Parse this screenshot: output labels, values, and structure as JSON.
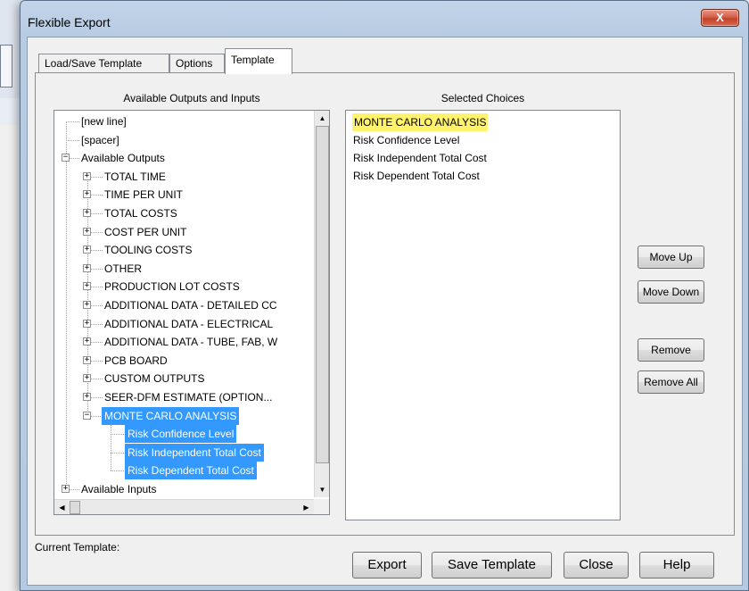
{
  "window": {
    "title": "Flexible Export",
    "close_glyph": "X"
  },
  "tabs": [
    {
      "label": "Load/Save Template"
    },
    {
      "label": "Options"
    },
    {
      "label": "Template"
    }
  ],
  "left_panel": {
    "header": "Available Outputs and Inputs"
  },
  "right_panel": {
    "header": "Selected Choices"
  },
  "tree": [
    {
      "label": "[new line]",
      "level": 1,
      "expander": "none"
    },
    {
      "label": "[spacer]",
      "level": 1,
      "expander": "none"
    },
    {
      "label": "Available Outputs",
      "level": 1,
      "expander": "minus"
    },
    {
      "label": "TOTAL TIME",
      "level": 2,
      "expander": "plus"
    },
    {
      "label": "TIME PER UNIT",
      "level": 2,
      "expander": "plus"
    },
    {
      "label": "TOTAL COSTS",
      "level": 2,
      "expander": "plus"
    },
    {
      "label": "COST PER UNIT",
      "level": 2,
      "expander": "plus"
    },
    {
      "label": "TOOLING COSTS",
      "level": 2,
      "expander": "plus"
    },
    {
      "label": "OTHER",
      "level": 2,
      "expander": "plus"
    },
    {
      "label": "PRODUCTION LOT COSTS",
      "level": 2,
      "expander": "plus"
    },
    {
      "label": "ADDITIONAL DATA - DETAILED CC",
      "level": 2,
      "expander": "plus"
    },
    {
      "label": "ADDITIONAL DATA - ELECTRICAL",
      "level": 2,
      "expander": "plus"
    },
    {
      "label": "ADDITIONAL DATA - TUBE, FAB, W",
      "level": 2,
      "expander": "plus"
    },
    {
      "label": "PCB BOARD",
      "level": 2,
      "expander": "plus"
    },
    {
      "label": "CUSTOM OUTPUTS",
      "level": 2,
      "expander": "plus"
    },
    {
      "label": "SEER-DFM ESTIMATE (OPTION...",
      "level": 2,
      "expander": "plus"
    },
    {
      "label": "MONTE CARLO ANALYSIS",
      "level": 2,
      "expander": "minus",
      "selected": true
    },
    {
      "label": "Risk Confidence Level",
      "level": 3,
      "expander": "none",
      "selected": true
    },
    {
      "label": "Risk Independent Total Cost",
      "level": 3,
      "expander": "none",
      "selected": true
    },
    {
      "label": "Risk Dependent Total Cost",
      "level": 3,
      "expander": "none",
      "selected": true
    },
    {
      "label": "Available Inputs",
      "level": 1,
      "expander": "plus"
    }
  ],
  "selected_choices": [
    {
      "label": "MONTE CARLO ANALYSIS",
      "highlighted": true
    },
    {
      "label": "Risk Confidence Level"
    },
    {
      "label": "Risk Independent Total Cost"
    },
    {
      "label": "Risk Dependent Total Cost"
    }
  ],
  "side_buttons": {
    "move_up": "Move Up",
    "move_down": "Move Down",
    "remove": "Remove",
    "remove_all": "Remove All"
  },
  "status": {
    "current_template_label": "Current Template:"
  },
  "footer_buttons": {
    "export": "Export",
    "save_template": "Save Template",
    "close": "Close",
    "help": "Help"
  },
  "colors": {
    "selection": "#3399ff",
    "highlight": "#fff36b",
    "title_bar": "#b7cbe2",
    "close_button": "#c3412b"
  }
}
